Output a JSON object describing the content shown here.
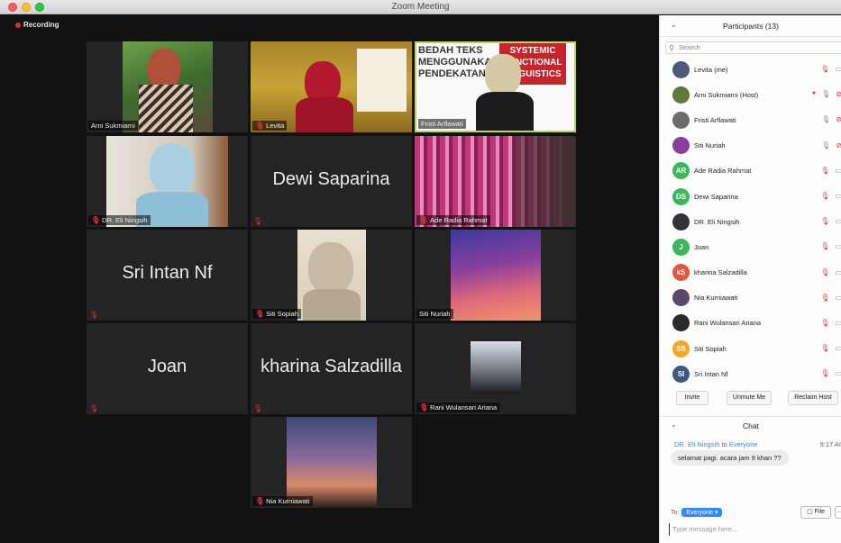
{
  "window": {
    "title": "Zoom Meeting"
  },
  "recording_label": "Recording",
  "tiles": {
    "arni": "Arni Sukmiarni",
    "levita": "Levita",
    "fristi": "Fristi Arflawati",
    "eli": "DR. Eli Ningsih",
    "dewi": "Dewi Saparina",
    "ade": "Ade Radia Rahmat",
    "sri": "Sri Intan Nf",
    "sofiah": "Siti Sopiah",
    "nuriah": "Siti Nuriah",
    "joan": "Joan",
    "kharina": "kharina Salzadilla",
    "rani": "Rani Wulansari Ariana",
    "nia": "Nia Kurniawati"
  },
  "slide_text": {
    "l1": "BEDAH TEKS",
    "l2": "MENGGUNAKAN",
    "l3": "PENDEKATAN",
    "r1": "SYSTEMIC",
    "r2": "FUNCTIONAL",
    "r3": "LINGUISTICS"
  },
  "participants_panel": {
    "title": "Participants (13)",
    "search_placeholder": "Search",
    "items": [
      {
        "name": "Levita (me)",
        "initials": "",
        "color": "#4a5a78"
      },
      {
        "name": "Arni Sukmiarni (Host)",
        "initials": "",
        "color": "#5d7a3a"
      },
      {
        "name": "Fristi Arflawati",
        "initials": "",
        "color": "#6b6b6b"
      },
      {
        "name": "Siti Nuriah",
        "initials": "",
        "color": "#8a3f9c"
      },
      {
        "name": "Ade Radia Rahmat",
        "initials": "AR",
        "color": "#3bb85a"
      },
      {
        "name": "Dewi Saparina",
        "initials": "DS",
        "color": "#3bb85a"
      },
      {
        "name": "DR. Eli Ningsih",
        "initials": "",
        "color": "#333333"
      },
      {
        "name": "Joan",
        "initials": "J",
        "color": "#3bb85a"
      },
      {
        "name": "kharina Salzadilla",
        "initials": "kS",
        "color": "#e4553c"
      },
      {
        "name": "Nia Kurniawati",
        "initials": "",
        "color": "#5a4a6a"
      },
      {
        "name": "Rani Wulansari Ariana",
        "initials": "",
        "color": "#2a2a2a"
      },
      {
        "name": "Siti Sopiah",
        "initials": "SS",
        "color": "#f5a623"
      },
      {
        "name": "Sri Intan Nf",
        "initials": "SI",
        "color": "#3a5a80"
      }
    ],
    "buttons": {
      "invite": "Invite",
      "unmute": "Unmute Me",
      "reclaim": "Reclaim Host"
    }
  },
  "chat": {
    "title": "Chat",
    "sender": "DR. Eli Ningsih",
    "to_word": "to",
    "recipient": "Everyone",
    "time": "9:17 AI",
    "message": "selamat pagi. acara jam 9 khan ??",
    "to_label": "To:",
    "to_value": "Everyone ▾",
    "file_label": "File",
    "more_label": "...",
    "input_placeholder": "Type message here..."
  }
}
